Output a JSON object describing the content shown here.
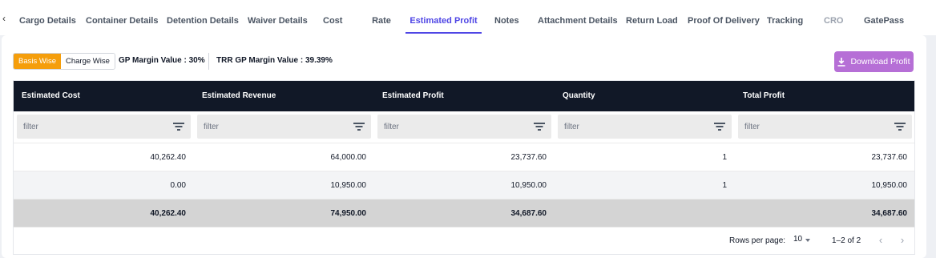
{
  "tabs": {
    "back_icon": "chevron-left-icon",
    "items": [
      {
        "label": "Cargo Details"
      },
      {
        "label": "Container Details"
      },
      {
        "label": "Detention Details"
      },
      {
        "label": "Waiver Details"
      },
      {
        "label": "Cost"
      },
      {
        "label": "Rate"
      },
      {
        "label": "Estimated Profit",
        "active": true
      },
      {
        "label": "Notes"
      },
      {
        "label": "Attachment Details"
      },
      {
        "label": "Return Load"
      },
      {
        "label": "Proof Of Delivery"
      },
      {
        "label": "Tracking"
      },
      {
        "label": "CRO",
        "disabled": true
      },
      {
        "label": "GatePass"
      }
    ]
  },
  "toolbar": {
    "basis_wise": "Basis Wise",
    "charge_wise": "Charge Wise",
    "selected": "Basis Wise",
    "gp_margin": "GP Margin Value : 30%",
    "trr_gp_margin": "TRR GP Margin Value : 39.39%",
    "download_label": "Download Profit",
    "download_icon": "download-icon"
  },
  "table": {
    "columns": [
      "Estimated Cost",
      "Estimated Revenue",
      "Estimated Profit",
      "Quantity",
      "Total Profit"
    ],
    "filter_placeholder": "filter",
    "rows": [
      [
        "40,262.40",
        "64,000.00",
        "23,737.60",
        "1",
        "23,737.60"
      ],
      [
        "0.00",
        "10,950.00",
        "10,950.00",
        "1",
        "10,950.00"
      ]
    ],
    "totals": [
      "40,262.40",
      "74,950.00",
      "34,687.60",
      "",
      "34,687.60"
    ]
  },
  "pagination": {
    "rows_per_page_label": "Rows per page:",
    "rows_per_page": "10",
    "range": "1–2 of 2",
    "prev_icon": "chevron-left-icon",
    "next_icon": "chevron-right-icon"
  },
  "colors": {
    "accent": "#4f46e5",
    "header_bg": "#111827",
    "toggle_active": "#f59e0b",
    "download_button": "#b66fd6"
  }
}
